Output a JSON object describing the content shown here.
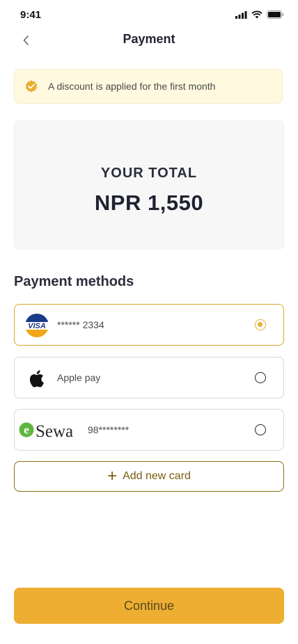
{
  "status": {
    "time": "9:41"
  },
  "nav": {
    "title": "Payment"
  },
  "discount": {
    "text": "A discount is applied for the first month"
  },
  "total": {
    "label": "YOUR TOTAL",
    "value": "NPR 1,550"
  },
  "methods": {
    "title": "Payment methods",
    "items": [
      {
        "name": "Visa",
        "label": "****** 2334",
        "selected": true
      },
      {
        "name": "Apple pay",
        "label": "Apple pay",
        "selected": false
      },
      {
        "name": "eSewa",
        "label": "98********",
        "selected": false
      }
    ]
  },
  "actions": {
    "add_card": "Add new card",
    "continue": "Continue"
  },
  "colors": {
    "accent": "#edae32",
    "discount_bg": "#fff9e0",
    "selected_border": "#d6a82a"
  }
}
